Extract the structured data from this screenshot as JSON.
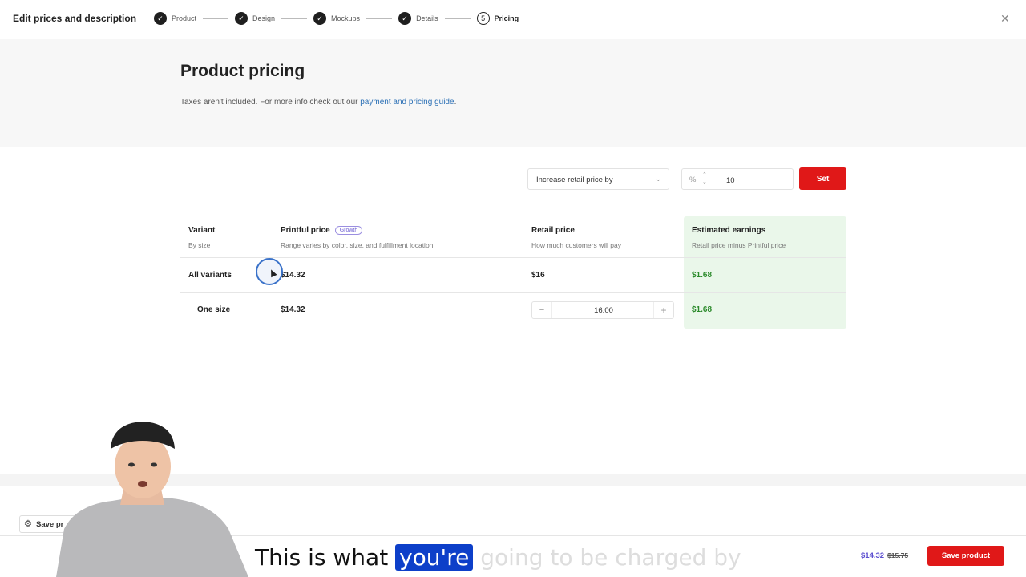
{
  "header": {
    "title": "Edit prices and description",
    "steps": [
      {
        "label": "Product",
        "marker": "✓"
      },
      {
        "label": "Design",
        "marker": "✓"
      },
      {
        "label": "Mockups",
        "marker": "✓"
      },
      {
        "label": "Details",
        "marker": "✓"
      },
      {
        "label": "Pricing",
        "marker": "5"
      }
    ],
    "close_glyph": "✕"
  },
  "page": {
    "title": "Product pricing",
    "note_text": "Taxes aren't included. For more info check out our ",
    "note_link": "payment and pricing guide",
    "note_end": "."
  },
  "controls": {
    "mode": "Increase retail price by",
    "unit": "%",
    "amount": "10",
    "set_label": "Set"
  },
  "table": {
    "columns": [
      {
        "title": "Variant",
        "subtitle": "By size"
      },
      {
        "title": "Printful price",
        "badge": "Growth",
        "subtitle": "Range varies by color, size, and fulfillment location"
      },
      {
        "title": "Retail price",
        "subtitle": "How much customers will pay"
      },
      {
        "title": "Estimated earnings",
        "subtitle": "Retail price minus Printful price"
      }
    ],
    "rows": [
      {
        "variant": "All variants",
        "printful_price": "$14.32",
        "retail_price": "$16",
        "earnings": "$1.68"
      },
      {
        "variant": "One size",
        "printful_price": "$14.32",
        "retail_price": "16.00",
        "earnings": "$1.68"
      }
    ]
  },
  "footer": {
    "draft_label": "Save pr",
    "price_current": "$14.32",
    "price_old": "$15.75",
    "save_label": "Save product"
  },
  "caption": {
    "before": "This is what ",
    "highlight": "you're",
    "after": " going to be charged by"
  },
  "colors": {
    "accent_red": "#e01818",
    "earnings_green": "#2b8a2b",
    "link_blue": "#2a6fb5",
    "badge_purple": "#6e5fd3",
    "caption_highlight": "#0d3fc9"
  }
}
